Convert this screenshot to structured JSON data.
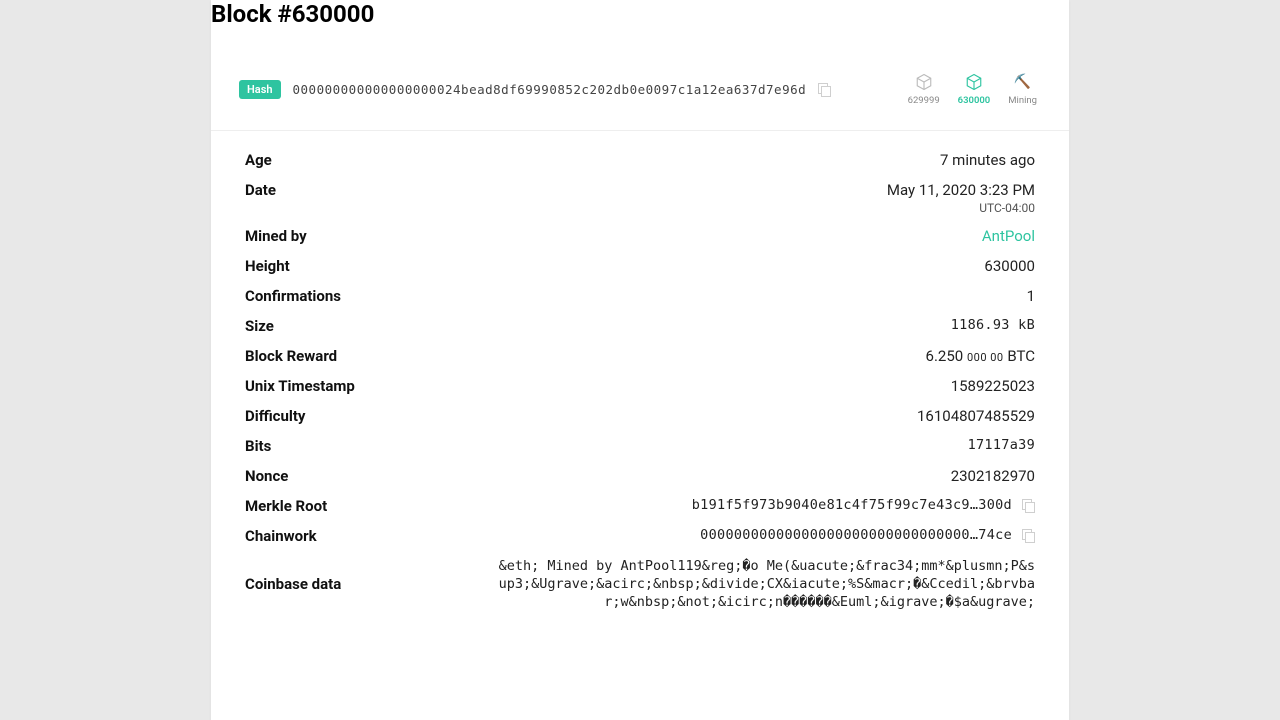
{
  "title": "Block #630000",
  "hash": {
    "badge": "Hash",
    "value": "000000000000000000024bead8df69990852c202db0e0097c1a12ea637d7e96d"
  },
  "nav": {
    "prev": "629999",
    "current": "630000",
    "mining": "Mining"
  },
  "rows": {
    "age": {
      "label": "Age",
      "value": "7 minutes ago"
    },
    "date": {
      "label": "Date",
      "value": "May 11, 2020 3:23 PM",
      "sub": "UTC-04:00"
    },
    "mined_by": {
      "label": "Mined by",
      "value": "AntPool"
    },
    "height": {
      "label": "Height",
      "value": "630000"
    },
    "confirmations": {
      "label": "Confirmations",
      "value": "1"
    },
    "size": {
      "label": "Size",
      "value": "1186.93 kB"
    },
    "reward": {
      "label": "Block Reward",
      "main": "6.250",
      "small": "000 00",
      "unit": "BTC"
    },
    "unix": {
      "label": "Unix Timestamp",
      "value": "1589225023"
    },
    "difficulty": {
      "label": "Difficulty",
      "value": "16104807485529"
    },
    "bits": {
      "label": "Bits",
      "value": "17117a39"
    },
    "nonce": {
      "label": "Nonce",
      "value": "2302182970"
    },
    "merkle": {
      "label": "Merkle Root",
      "value": "b191f5f973b9040e81c4f75f99c7e43c9…300d"
    },
    "chainwork": {
      "label": "Chainwork",
      "value": "00000000000000000000000000000000…74ce"
    },
    "coinbase": {
      "label": "Coinbase data",
      "value": "&eth; Mined by AntPool119&reg;�o Me(&uacute;&frac34;mm*&plusmn;P&sup3;&Ugrave;&acirc;&nbsp;&divide;CX&iacute;%S&macr;�&Ccedil;&brvbar;w&nbsp;&not;&icirc;n������&Euml;&igrave;�$a&ugrave;"
    }
  }
}
